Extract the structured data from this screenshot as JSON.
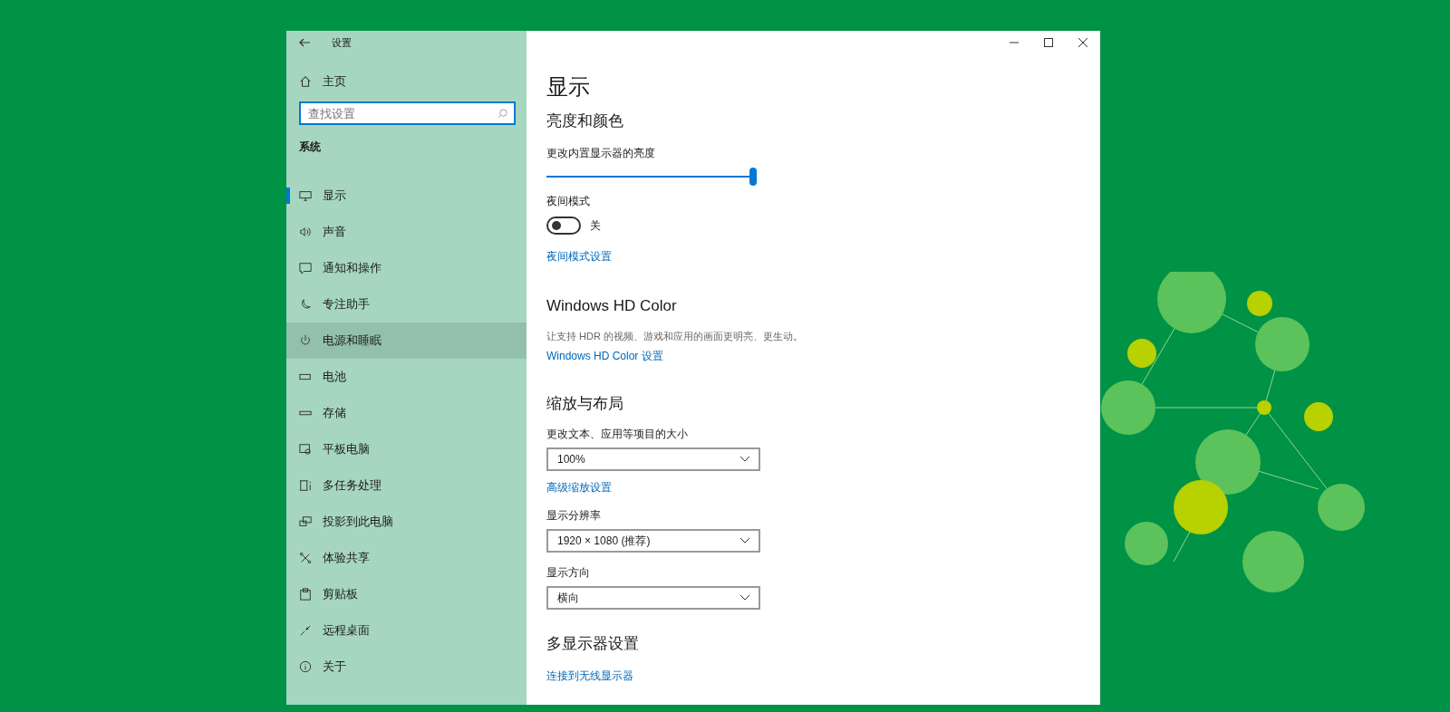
{
  "window": {
    "title": "设置"
  },
  "sidebar": {
    "home": "主页",
    "search": {
      "placeholder": "查找设置"
    },
    "section": "系统",
    "items": [
      {
        "label": "显示",
        "selected": true,
        "hovered": false
      },
      {
        "label": "声音",
        "selected": false,
        "hovered": false
      },
      {
        "label": "通知和操作",
        "selected": false,
        "hovered": false
      },
      {
        "label": "专注助手",
        "selected": false,
        "hovered": false
      },
      {
        "label": "电源和睡眠",
        "selected": false,
        "hovered": true
      },
      {
        "label": "电池",
        "selected": false,
        "hovered": false
      },
      {
        "label": "存储",
        "selected": false,
        "hovered": false
      },
      {
        "label": "平板电脑",
        "selected": false,
        "hovered": false
      },
      {
        "label": "多任务处理",
        "selected": false,
        "hovered": false
      },
      {
        "label": "投影到此电脑",
        "selected": false,
        "hovered": false
      },
      {
        "label": "体验共享",
        "selected": false,
        "hovered": false
      },
      {
        "label": "剪贴板",
        "selected": false,
        "hovered": false
      },
      {
        "label": "远程桌面",
        "selected": false,
        "hovered": false
      },
      {
        "label": "关于",
        "selected": false,
        "hovered": false
      }
    ]
  },
  "content": {
    "title": "显示",
    "brightness": {
      "heading": "亮度和颜色",
      "label": "更改内置显示器的亮度",
      "level": 1.0
    },
    "night_light": {
      "label": "夜间模式",
      "on": false,
      "state_text": "关",
      "link": "夜间模式设置"
    },
    "hd_color": {
      "heading": "Windows HD Color",
      "description": "让支持 HDR 的视频、游戏和应用的画面更明亮、更生动。",
      "link": "Windows HD Color 设置"
    },
    "scale": {
      "heading": "缩放与布局",
      "fields": [
        {
          "label": "更改文本、应用等项目的大小",
          "value": "100%",
          "link": "高级缩放设置"
        },
        {
          "label": "显示分辨率",
          "value": "1920 × 1080 (推荐)"
        },
        {
          "label": "显示方向",
          "value": "横向"
        }
      ]
    },
    "multi": {
      "heading": "多显示器设置",
      "link": "连接到无线显示器"
    }
  }
}
